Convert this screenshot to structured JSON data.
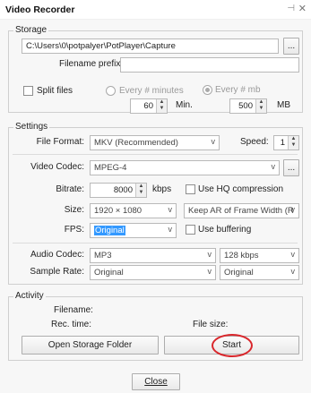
{
  "window": {
    "title": "Video Recorder",
    "pin_icon": "pin-icon",
    "close_icon": "close-icon"
  },
  "storage": {
    "group_title": "Storage",
    "path": "C:\\Users\\0\\potpalyer\\PotPlayer\\Capture",
    "browse_label": "...",
    "prefix_label": "Filename prefix:",
    "prefix_value": "",
    "split_label": "Split files",
    "every_minutes_label": "Every # minutes",
    "every_mb_label": "Every # mb",
    "minutes_value": "60",
    "minutes_unit": "Min.",
    "mb_value": "500",
    "mb_unit": "MB"
  },
  "settings": {
    "group_title": "Settings",
    "file_format_label": "File Format:",
    "file_format_value": "MKV (Recommended)",
    "speed_label": "Speed:",
    "speed_value": "1",
    "video_codec_label": "Video Codec:",
    "video_codec_value": "MPEG-4",
    "video_codec_more": "...",
    "bitrate_label": "Bitrate:",
    "bitrate_value": "8000",
    "bitrate_unit": "kbps",
    "hq_label": "Use HQ compression",
    "size_label": "Size:",
    "size_value": "1920 × 1080",
    "aspect_value": "Keep AR of Frame Width (R",
    "fps_label": "FPS:",
    "fps_value": "Original",
    "buffering_label": "Use buffering",
    "audio_codec_label": "Audio Codec:",
    "audio_codec_value": "MP3",
    "audio_bitrate_value": "128 kbps",
    "sample_rate_label": "Sample Rate:",
    "sample_rate_value": "Original",
    "channels_value": "Original",
    "chevron": "v"
  },
  "activity": {
    "group_title": "Activity",
    "filename_label": "Filename:",
    "rec_time_label": "Rec. time:",
    "file_size_label": "File size:",
    "open_folder_label": "Open Storage Folder",
    "start_label": "Start"
  },
  "footer": {
    "close_label": "Close"
  },
  "colors": {
    "annotation": "#d9262b",
    "selection": "#3399ff"
  }
}
